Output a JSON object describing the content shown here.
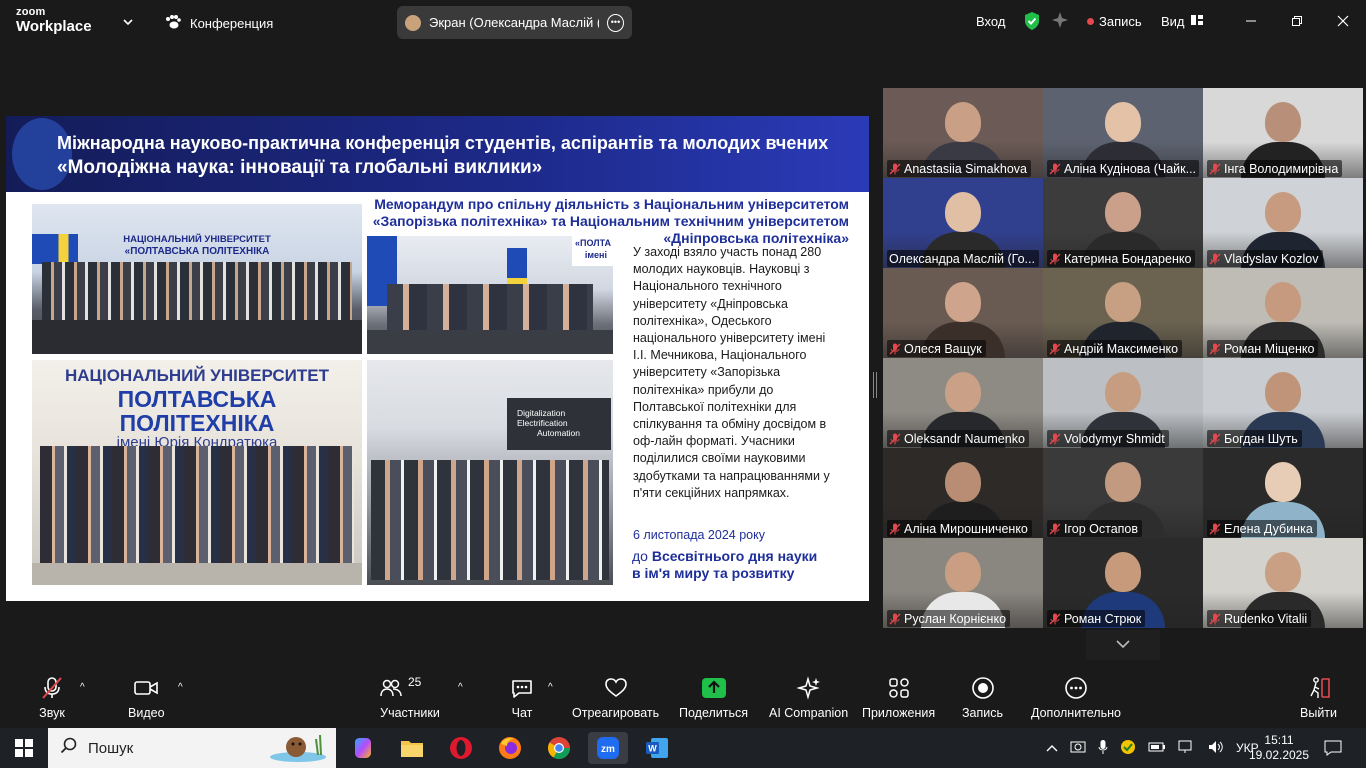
{
  "topbar": {
    "logo_line1": "zoom",
    "logo_line2": "Workplace",
    "meeting_label": "Конференция",
    "share_label": "Экран (Олександра Маслій (Го...",
    "signin": "Вход",
    "recording": "Запись",
    "view": "Вид"
  },
  "slide": {
    "title_line1": "Міжнародна науково-практична конференція студентів, аспірантів та молодих вчених",
    "title_line2": "«Молодіжна наука: інновації та глобальні виклики»",
    "memo": "Меморандум про спільну діяльність з Національним університетом «Запорізька політехніка» та Національним технічним університетом «Дніпровська політехніка»",
    "photo1_caption_a": "НАЦІОНАЛЬНИЙ УНІВЕРСИТЕТ",
    "photo1_caption_b": "«ПОЛТАВСЬКА ПОЛІТЕХНІКА",
    "photo2_caption": "«ПОЛТА",
    "photo2_caption_b": "імені",
    "photo3_line1": "НАЦІОНАЛЬНИЙ УНІВЕРСИТЕТ",
    "photo3_line2": "ПОЛТАВСЬКА",
    "photo3_line3": "ПОЛІТЕХНІКА",
    "photo3_line4": "імені Юрія Кондратюка",
    "photo4_sign1": "Digitalization",
    "photo4_sign2": "Electrification",
    "photo4_sign3": "Automation",
    "body": "У заході взяло участь понад 280 молодих науковців. Науковці з Національного технічного університету «Дніпровська політехніка», Одеського національного університету імені І.І. Мечникова, Національного університету «Запорізька політехніка» прибули до Полтавської політехніки для спілкування та обміну досвідом в оф-лайн форматі. Учасники поділилися своїми науковими здобутками та напрацюваннями у п'яти секційних напрямках.",
    "date": "6 листопада 2024 року",
    "slogan_prefix": "до",
    "slogan_line1": "Всесвітнього дня науки",
    "slogan_line2": "в ім'я миру та розвитку"
  },
  "participants": [
    {
      "name": "Anastasiia Simakhova",
      "muted": true,
      "bg": "#6b5a55",
      "skin": "#c99f86",
      "shirt": "#3a3a45"
    },
    {
      "name": "Аліна Кудінова (Чайк...",
      "muted": true,
      "bg": "#5d6270",
      "skin": "#e4c2a8",
      "shirt": "#2d2d35"
    },
    {
      "name": "Інга Володимирівна",
      "muted": true,
      "bg": "#d8d8d8",
      "skin": "#b88f78",
      "shirt": "#222"
    },
    {
      "name": "Олександра Маслій (Го...",
      "muted": false,
      "bg": "#31408e",
      "skin": "#e1bfa5",
      "shirt": "#2a2a2a",
      "active": true
    },
    {
      "name": "Катерина Бондаренко",
      "muted": true,
      "bg": "#3c3c3c",
      "skin": "#caa08b",
      "shirt": "#2a2a2a"
    },
    {
      "name": "Vladyslav Kozlov",
      "muted": true,
      "bg": "#cfd2d6",
      "skin": "#c79b80",
      "shirt": "#1e2430"
    },
    {
      "name": "Олеся Ващук",
      "muted": true,
      "bg": "#6a5b52",
      "skin": "#cfa48c",
      "shirt": "#3b2f2a"
    },
    {
      "name": "Андрій Максименко",
      "muted": true,
      "bg": "#6b6250",
      "skin": "#c7a084",
      "shirt": "#20242c"
    },
    {
      "name": "Роман Міщенко",
      "muted": true,
      "bg": "#bfbcb6",
      "skin": "#c59a7e",
      "shirt": "#2c2c2c"
    },
    {
      "name": "Oleksandr Naumenko",
      "muted": true,
      "bg": "#8e8a84",
      "skin": "#caa086",
      "shirt": "#26282c"
    },
    {
      "name": "Volodymyr Shmidt",
      "muted": true,
      "bg": "#bcc0c4",
      "skin": "#c79d82",
      "shirt": "#2f3238"
    },
    {
      "name": "Богдан Шуть",
      "muted": true,
      "bg": "#c9ccd0",
      "skin": "#c09478",
      "shirt": "#2a3a55"
    },
    {
      "name": "Аліна Мирошниченко",
      "muted": true,
      "bg": "#2e2a28",
      "skin": "#b88d74",
      "shirt": "#1e1e1e"
    },
    {
      "name": "Ігор Остапов",
      "muted": true,
      "bg": "#3a3a3a",
      "skin": "#c29a80",
      "shirt": "#2d2d2d"
    },
    {
      "name": "Елена Дубинка",
      "muted": true,
      "bg": "#2a2a2a",
      "skin": "#e8cdb6",
      "shirt": "#8fb3c9"
    },
    {
      "name": "Руслан Корнієнко",
      "muted": true,
      "bg": "#8a8680",
      "skin": "#c99e83",
      "shirt": "#e8e8e8"
    },
    {
      "name": "Роман Стрюк",
      "muted": true,
      "bg": "#2a2a2a",
      "skin": "#c79a7c",
      "shirt": "#1f3a7a"
    },
    {
      "name": "Rudenko Vitalii",
      "muted": true,
      "bg": "#d4d2cd",
      "skin": "#c9a084",
      "shirt": "#2a2a2a"
    }
  ],
  "toolbar": {
    "audio": "Звук",
    "video": "Видео",
    "participants": "Участники",
    "participants_count": "25",
    "chat": "Чат",
    "react": "Отреагировать",
    "share": "Поделиться",
    "ai": "AI Companion",
    "apps": "Приложения",
    "record": "Запись",
    "more": "Дополнительно",
    "leave": "Выйти"
  },
  "taskbar": {
    "search_placeholder": "Пошук",
    "lang": "УКР",
    "time": "15:11",
    "date": "19.02.2025"
  },
  "colors": {
    "accent_green": "#2fd46b",
    "share_green": "#1fbf4a",
    "record_red": "#e5484d",
    "muted_red": "#e5484d",
    "slide_blue": "#1f2f9a"
  }
}
